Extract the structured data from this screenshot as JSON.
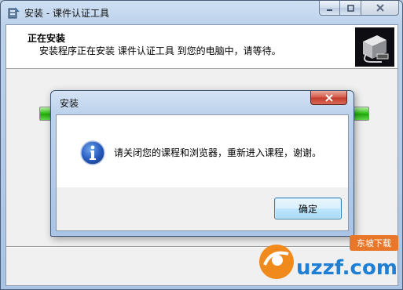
{
  "window": {
    "title": "安装 - 课件认证工具"
  },
  "header": {
    "title": "正在安装",
    "subtitle": "安装程序正在安装 课件认证工具 到您的电脑中，请等待。"
  },
  "progress": {
    "fraction": 1.0
  },
  "dialog": {
    "title": "安装",
    "message": "请关闭您的课程和浏览器，重新进入课程，谢谢。",
    "ok_label": "确定"
  },
  "watermark": {
    "brand": "uzzf.com",
    "tag": "东坡下载"
  },
  "colors": {
    "accent": "#3c7fb1",
    "progress": "#23a80e",
    "close": "#c23a2a"
  }
}
